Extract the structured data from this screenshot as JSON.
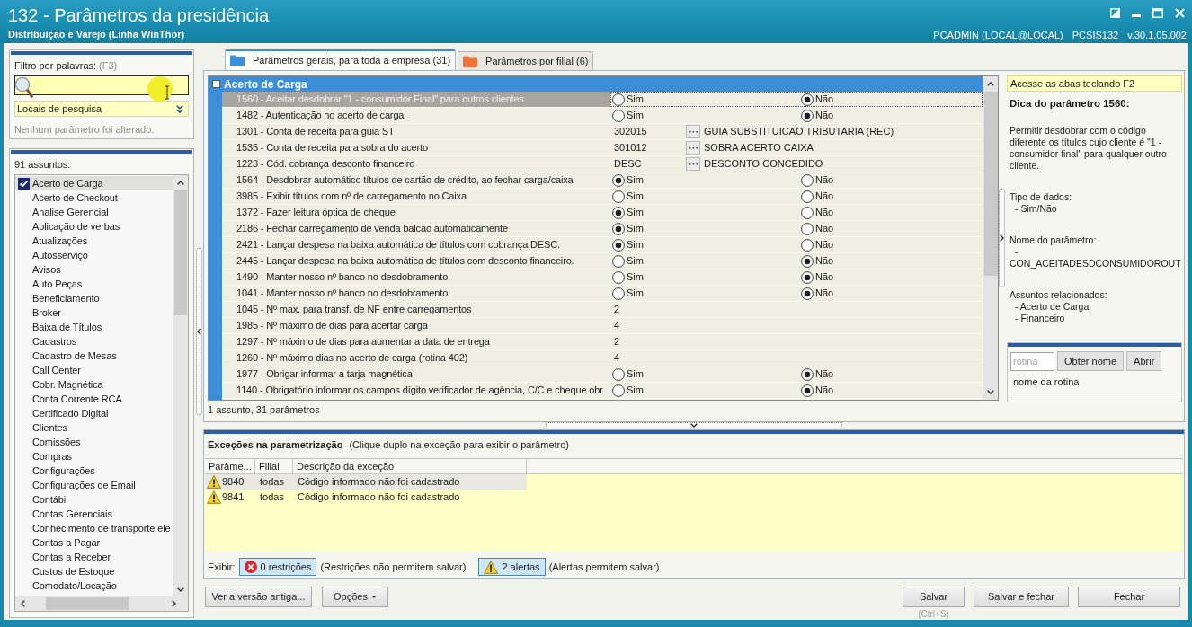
{
  "window": {
    "title": "132 - Parâmetros da presidência",
    "subtitle": "Distribuição e Varejo (Linha WinThor)",
    "user": "PCADMIN (LOCAL@LOCAL)",
    "routine": "PCSIS132",
    "version": "v.30.1.05.002"
  },
  "filter": {
    "label": "Filtro por palavras:",
    "shortcut": "(F3)",
    "search_locations": "Locais de pesquisa",
    "status": "Nenhum parâmetro foi alterado."
  },
  "subjects": {
    "count_label": "91 assuntos:",
    "items": [
      {
        "label": "Acerto de Carga",
        "checked": true,
        "selected": true
      },
      {
        "label": "Acerto de Checkout",
        "checked": false,
        "selected": false
      },
      {
        "label": "Analise Gerencial",
        "checked": false,
        "selected": false
      },
      {
        "label": "Aplicação de verbas",
        "checked": false,
        "selected": false
      },
      {
        "label": "Atualizações",
        "checked": false,
        "selected": false
      },
      {
        "label": "Autosserviço",
        "checked": false,
        "selected": false
      },
      {
        "label": "Avisos",
        "checked": false,
        "selected": false
      },
      {
        "label": "Auto Peças",
        "checked": false,
        "selected": false
      },
      {
        "label": "Beneficiamento",
        "checked": false,
        "selected": false
      },
      {
        "label": "Broker",
        "checked": false,
        "selected": false
      },
      {
        "label": "Baixa de Títulos",
        "checked": false,
        "selected": false
      },
      {
        "label": "Cadastros",
        "checked": false,
        "selected": false
      },
      {
        "label": "Cadastro de Mesas",
        "checked": false,
        "selected": false
      },
      {
        "label": "Call Center",
        "checked": false,
        "selected": false
      },
      {
        "label": "Cobr. Magnética",
        "checked": false,
        "selected": false
      },
      {
        "label": "Conta Corrente RCA",
        "checked": false,
        "selected": false
      },
      {
        "label": "Certificado Digital",
        "checked": false,
        "selected": false
      },
      {
        "label": "Clientes",
        "checked": false,
        "selected": false
      },
      {
        "label": "Comissões",
        "checked": false,
        "selected": false
      },
      {
        "label": "Compras",
        "checked": false,
        "selected": false
      },
      {
        "label": "Configurações",
        "checked": false,
        "selected": false
      },
      {
        "label": "Configurações de Email",
        "checked": false,
        "selected": false
      },
      {
        "label": "Contábil",
        "checked": false,
        "selected": false
      },
      {
        "label": "Contas Gerenciais",
        "checked": false,
        "selected": false
      },
      {
        "label": "Conhecimento de transporte ele",
        "checked": false,
        "selected": false
      },
      {
        "label": "Contas a Pagar",
        "checked": false,
        "selected": false
      },
      {
        "label": "Contas a Receber",
        "checked": false,
        "selected": false
      },
      {
        "label": "Custos de Estoque",
        "checked": false,
        "selected": false
      },
      {
        "label": "Comodato/Locação",
        "checked": false,
        "selected": false
      }
    ]
  },
  "tabs": [
    {
      "label": "Parâmetros gerais, para toda a empresa (31)",
      "selected": true,
      "color": "#3b8fd8"
    },
    {
      "label": "Parâmetros por filial (6)",
      "selected": false,
      "color": "#f0743a"
    }
  ],
  "parameters": {
    "group": "Acerto de Carga",
    "expanded": true,
    "rows": [
      {
        "kind": "yesno",
        "label": "1560 - Aceitar desdobrar \"1 - consumidor Final\" para outros clientes",
        "selected": true,
        "options": [
          {
            "label": "Sim",
            "checked": false
          },
          {
            "label": "Não",
            "checked": true
          }
        ]
      },
      {
        "kind": "yesno",
        "label": "1482 - Autenticação no acerto de carga",
        "selected": false,
        "options": [
          {
            "label": "Sim",
            "checked": false
          },
          {
            "label": "Não",
            "checked": true
          }
        ]
      },
      {
        "kind": "lookup",
        "label": "1301 - Conta de receita para guia ST",
        "selected": false,
        "code": "302015",
        "description": "GUIA SUBSTITUICAO TRIBUTARIA (REC)"
      },
      {
        "kind": "lookup",
        "label": "1535 - Conta de receita para sobra do acerto",
        "selected": false,
        "code": "301012",
        "description": "SOBRA ACERTO CAIXA"
      },
      {
        "kind": "lookup",
        "label": "1223 - Cód. cobrança desconto financeiro",
        "selected": false,
        "code": "DESC",
        "description": "DESCONTO CONCEDIDO"
      },
      {
        "kind": "yesno",
        "label": "1564 - Desdobrar automático títulos de cartão de crédito, ao fechar carga/caixa",
        "selected": false,
        "options": [
          {
            "label": "Sim",
            "checked": true
          },
          {
            "label": "Não",
            "checked": false
          }
        ]
      },
      {
        "kind": "yesno",
        "label": "3985 - Exibir títulos com nº de carregamento no Caixa",
        "selected": false,
        "options": [
          {
            "label": "Sim",
            "checked": false
          },
          {
            "label": "Não",
            "checked": false
          }
        ]
      },
      {
        "kind": "yesno",
        "label": "1372 - Fazer leitura óptica de cheque",
        "selected": false,
        "options": [
          {
            "label": "Sim",
            "checked": true
          },
          {
            "label": "Não",
            "checked": false
          }
        ]
      },
      {
        "kind": "yesno",
        "label": "2186 - Fechar carregamento de venda balcão automaticamente",
        "selected": false,
        "options": [
          {
            "label": "Sim",
            "checked": true
          },
          {
            "label": "Não",
            "checked": false
          }
        ]
      },
      {
        "kind": "yesno",
        "label": "2421 - Lançar despesa na baixa automática de títulos com cobrança DESC.",
        "selected": false,
        "options": [
          {
            "label": "Sim",
            "checked": true
          },
          {
            "label": "Não",
            "checked": false
          }
        ]
      },
      {
        "kind": "yesno",
        "label": "2445 - Lançar despesa na baixa automática de títulos com desconto financeiro.",
        "selected": false,
        "options": [
          {
            "label": "Sim",
            "checked": false
          },
          {
            "label": "Não",
            "checked": true
          }
        ]
      },
      {
        "kind": "yesno",
        "label": "1490 - Manter nosso nº banco no desdobramento",
        "selected": false,
        "options": [
          {
            "label": "Sim",
            "checked": false
          },
          {
            "label": "Não",
            "checked": true
          }
        ]
      },
      {
        "kind": "yesno",
        "label": "1041 - Manter nosso nº banco no desdobramento",
        "selected": false,
        "options": [
          {
            "label": "Sim",
            "checked": false
          },
          {
            "label": "Não",
            "checked": true
          }
        ]
      },
      {
        "kind": "number",
        "label": "1045 - Nº max. para transf. de NF entre carregamentos",
        "selected": false,
        "value": "2"
      },
      {
        "kind": "number",
        "label": "1985 - Nº máximo de dias para acertar carga",
        "selected": false,
        "value": "4"
      },
      {
        "kind": "number",
        "label": "1297 - Nº máximo de dias para aumentar a data de entrega",
        "selected": false,
        "value": "2"
      },
      {
        "kind": "number",
        "label": "1260 - Nº máximo dias no acerto de carga (rotina 402)",
        "selected": false,
        "value": "4"
      },
      {
        "kind": "yesno",
        "label": "1977 - Obrigar informar a tarja magnética",
        "selected": false,
        "options": [
          {
            "label": "Sim",
            "checked": false
          },
          {
            "label": "Não",
            "checked": true
          }
        ]
      },
      {
        "kind": "yesno",
        "label": "1140 - Obrigatório informar os campos dígito verificador de agência, C/C e cheque obr",
        "selected": false,
        "options": [
          {
            "label": "Sim",
            "checked": false
          },
          {
            "label": "Não",
            "checked": true
          }
        ]
      }
    ],
    "summary": "1 assunto, 31 parâmetros"
  },
  "tip": {
    "banner": "Acesse as abas teclando F2",
    "title": "Dica do parâmetro 1560:",
    "description": "Permitir desdobrar com o código diferente os títulos cujo cliente é \"1 - consumidor final\" para qualquer outro cliente.",
    "sections": [
      {
        "heading": "Tipo de dados:",
        "lines": [
          "- Sim/Não"
        ]
      },
      {
        "heading": "Nome do parâmetro:",
        "lines": [
          "- CON_ACEITADESDCONSUMIDOROUT"
        ]
      },
      {
        "heading": "Assuntos relacionados:",
        "lines": [
          "- Acerto de Carga",
          "- Financeiro"
        ]
      }
    ]
  },
  "routine": {
    "placeholder": "rotina",
    "buttons": [
      "Obter nome",
      "Abrir"
    ],
    "result": "nome da rotina"
  },
  "exceptions": {
    "title": "Exceções na parametrização",
    "hint": "(Clique duplo na exceção para exibir o parâmetro)",
    "columns": [
      "Parâme...",
      "Filial",
      "Descrição da exceção"
    ],
    "rows": [
      {
        "kind": "warning",
        "parameter": "9840",
        "branch": "todas",
        "description": "Código informado não foi cadastrado",
        "selected": true
      },
      {
        "kind": "warning",
        "parameter": "9841",
        "branch": "todas",
        "description": "Código informado não foi cadastrado",
        "selected": false
      }
    ],
    "filter_label": "Exibir:",
    "filters": [
      {
        "kind": "error",
        "label": "0 restrições",
        "note": "(Restrições não permitem salvar)",
        "pressed": true
      },
      {
        "kind": "warning",
        "label": "2 alertas",
        "note": "(Alertas permitem salvar)",
        "pressed": true
      }
    ]
  },
  "actions": {
    "left": [
      {
        "kind": "plain",
        "label": "Ver a versão antiga..."
      },
      {
        "kind": "menu",
        "label": "Opções"
      }
    ],
    "right": [
      {
        "label": "Salvar",
        "hint": "(Ctrl+S)"
      },
      {
        "label": "Salvar e fechar"
      },
      {
        "label": "Fechar"
      }
    ]
  }
}
